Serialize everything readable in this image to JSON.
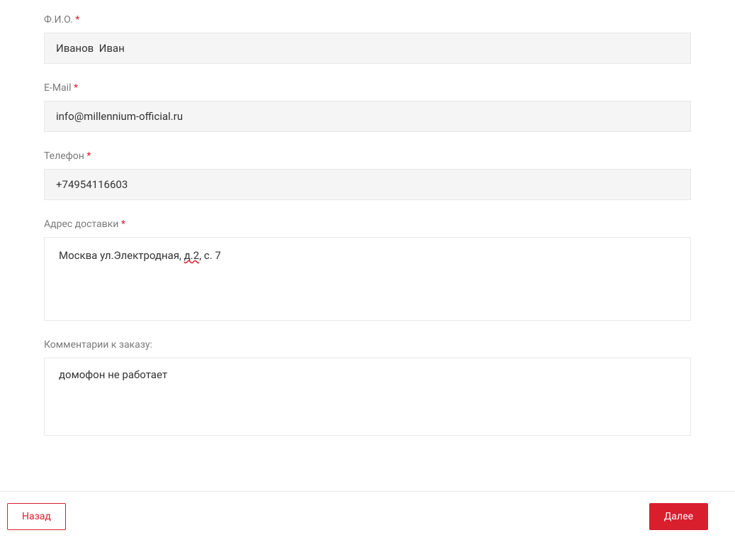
{
  "fields": {
    "fullname": {
      "label": "Ф.И.О.",
      "required": "*",
      "value": "Иванов  Иван"
    },
    "email": {
      "label": "E-Mail",
      "required": "*",
      "value": "info@millennium-official.ru"
    },
    "phone": {
      "label": "Телефон",
      "required": "*",
      "value": "+74954116603"
    },
    "address": {
      "label": "Адрес доставки",
      "required": "*",
      "parts": {
        "p1": "Москва ул.Электродная, ",
        "p2": "д.2",
        "p3": ", с. 7"
      }
    },
    "comment": {
      "label": "Комментарии к заказу:",
      "value": "домофон не работает"
    }
  },
  "buttons": {
    "back": "Назад",
    "next": "Далее"
  }
}
